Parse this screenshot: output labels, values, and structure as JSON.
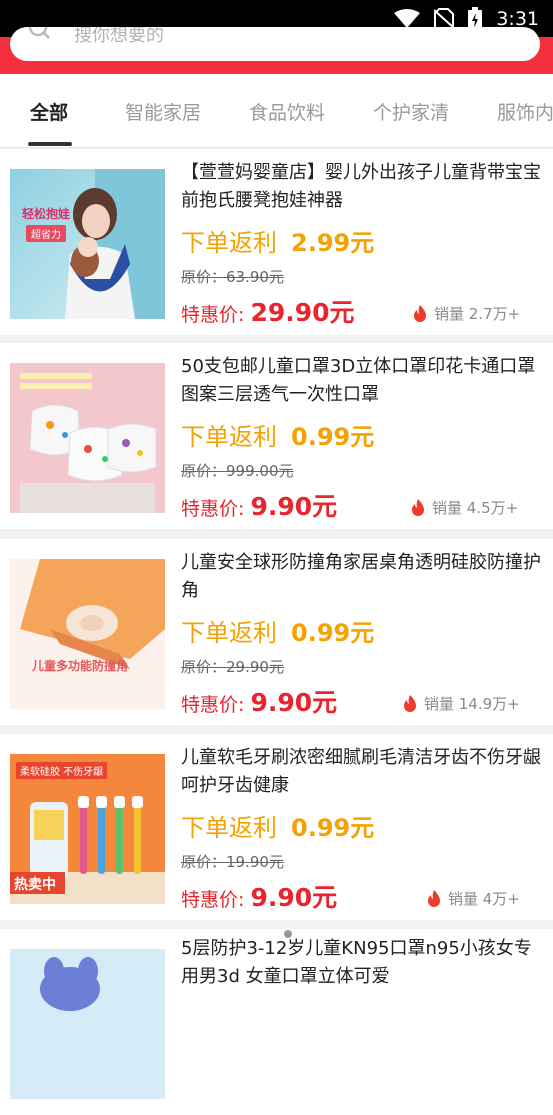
{
  "status": {
    "time": "3:31"
  },
  "search": {
    "placeholder": "搜你想要的"
  },
  "tabs": [
    {
      "label": "全部"
    },
    {
      "label": "智能家居"
    },
    {
      "label": "食品饮料"
    },
    {
      "label": "个护家清"
    },
    {
      "label": "服饰内"
    }
  ],
  "products": [
    {
      "title": "【萱萱妈婴童店】婴儿外出孩子儿童背带宝宝前抱氏腰凳抱娃神器",
      "rebate_label": "下单返利",
      "rebate_value": "2.99元",
      "orig_price": "原价：63.90元",
      "price_label": "特惠价: ",
      "price_value": "29.90元",
      "sales": "销量 2.7万+",
      "thumb_text_1": "轻松抱娃",
      "thumb_text_2": "超省力"
    },
    {
      "title": "50支包邮儿童口罩3D立体口罩印花卡通口罩图案三层透气一次性口罩",
      "rebate_label": "下单返利",
      "rebate_value": "0.99元",
      "orig_price": "原价：999.00元",
      "price_label": "特惠价: ",
      "price_value": "9.90元",
      "sales": "销量 4.5万+"
    },
    {
      "title": "儿童安全球形防撞角家居桌角透明硅胶防撞护角",
      "rebate_label": "下单返利",
      "rebate_value": "0.99元",
      "orig_price": "原价：29.90元",
      "price_label": "特惠价: ",
      "price_value": "9.90元",
      "sales": "销量 14.9万+",
      "thumb_text_1": "儿童多功能防撞角"
    },
    {
      "title": "儿童软毛牙刷浓密细腻刷毛清洁牙齿不伤牙龈呵护牙齿健康",
      "rebate_label": "下单返利",
      "rebate_value": "0.99元",
      "orig_price": "原价：19.90元",
      "price_label": "特惠价: ",
      "price_value": "9.90元",
      "sales": "销量 4万+",
      "thumb_text_1": "柔软硅胶 不伤牙龈",
      "thumb_text_2": "热卖中"
    },
    {
      "title": "5层防护3-12岁儿童KN95口罩n95小孩女专用男3d 女童口罩立体可爱"
    }
  ],
  "colors": {
    "brand_red": "#f2303d",
    "rebate_orange": "#f5a200",
    "price_red": "#e8252e"
  }
}
